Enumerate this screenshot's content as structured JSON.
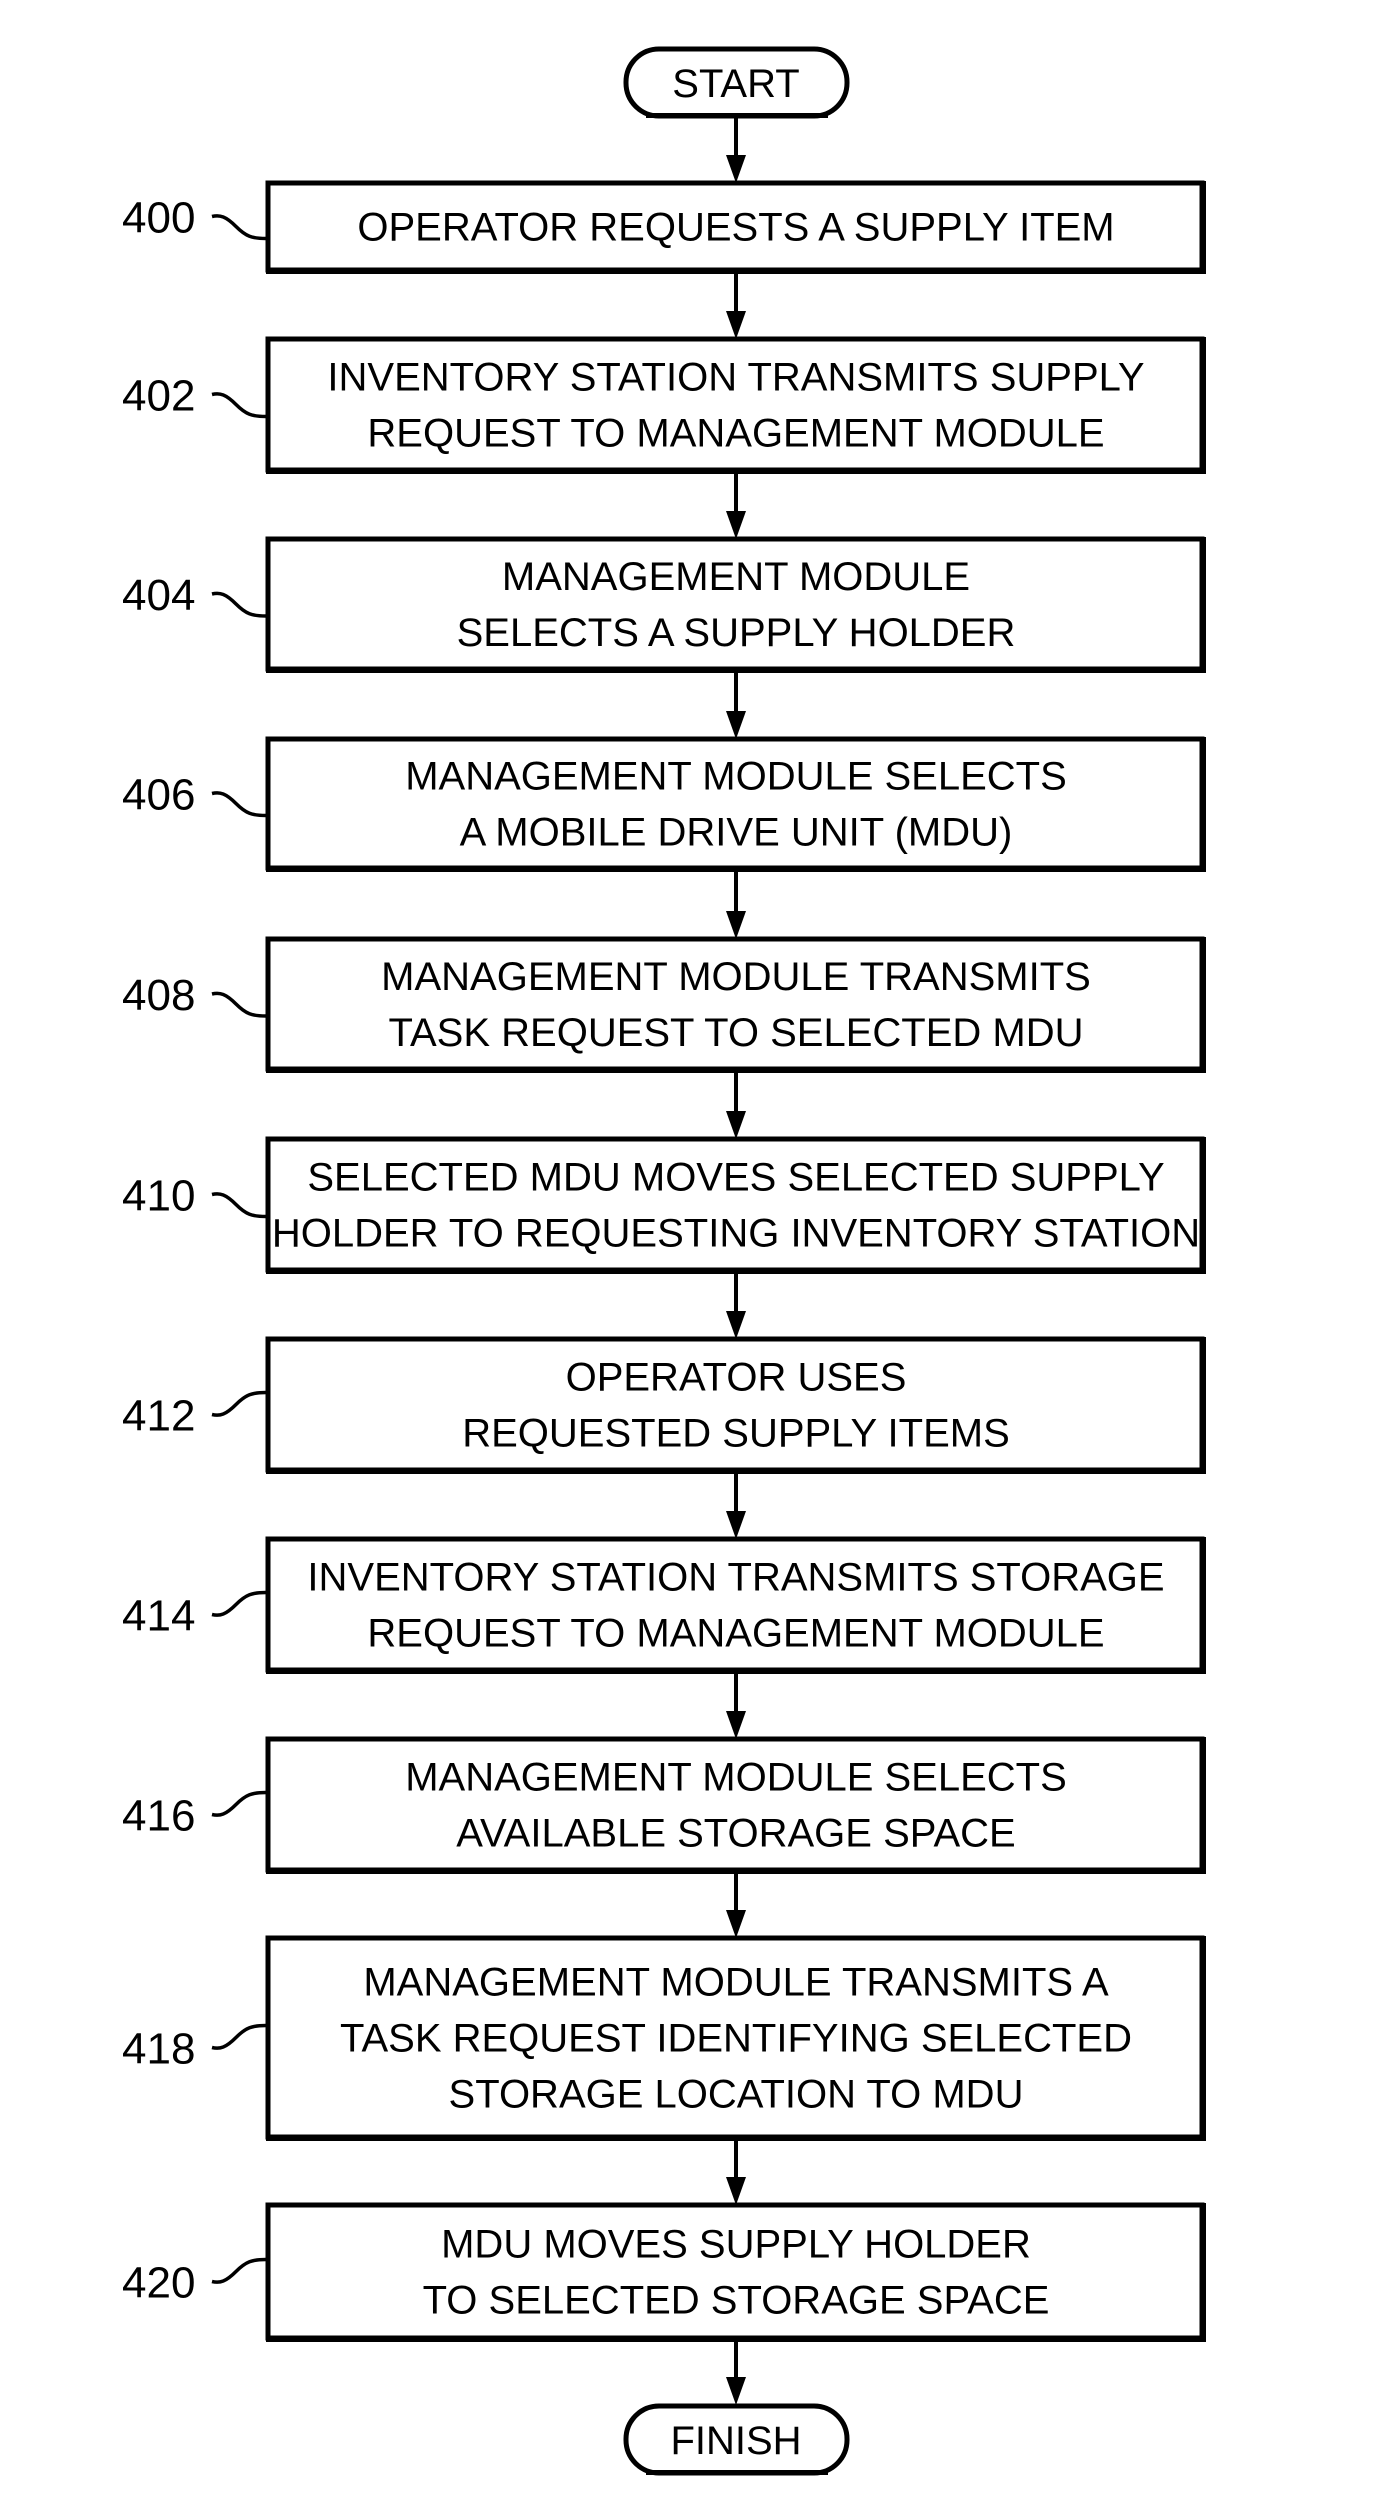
{
  "figure": {
    "type": "flowchart",
    "colors": {
      "stroke": "#000000",
      "background": "#ffffff",
      "text": "#000000"
    }
  },
  "start": {
    "label": "START"
  },
  "finish": {
    "label": "FINISH"
  },
  "steps": [
    {
      "ref": "400",
      "lines": [
        "OPERATOR REQUESTS A SUPPLY ITEM"
      ]
    },
    {
      "ref": "402",
      "lines": [
        "INVENTORY STATION TRANSMITS SUPPLY",
        "REQUEST TO MANAGEMENT MODULE"
      ]
    },
    {
      "ref": "404",
      "lines": [
        "MANAGEMENT MODULE",
        "SELECTS A SUPPLY HOLDER"
      ]
    },
    {
      "ref": "406",
      "lines": [
        "MANAGEMENT MODULE SELECTS",
        "A MOBILE DRIVE UNIT (MDU)"
      ]
    },
    {
      "ref": "408",
      "lines": [
        "MANAGEMENT MODULE TRANSMITS",
        "TASK REQUEST TO SELECTED MDU"
      ]
    },
    {
      "ref": "410",
      "lines": [
        "SELECTED MDU MOVES SELECTED SUPPLY",
        "HOLDER TO REQUESTING INVENTORY STATION"
      ]
    },
    {
      "ref": "412",
      "lines": [
        "OPERATOR USES",
        "REQUESTED SUPPLY ITEMS"
      ]
    },
    {
      "ref": "414",
      "lines": [
        "INVENTORY STATION TRANSMITS STORAGE",
        "REQUEST TO MANAGEMENT MODULE"
      ]
    },
    {
      "ref": "416",
      "lines": [
        "MANAGEMENT MODULE SELECTS",
        "AVAILABLE STORAGE SPACE"
      ]
    },
    {
      "ref": "418",
      "lines": [
        "MANAGEMENT MODULE TRANSMITS A",
        "TASK REQUEST IDENTIFYING SELECTED",
        "STORAGE LOCATION TO MDU"
      ]
    },
    {
      "ref": "420",
      "lines": [
        "MDU MOVES SUPPLY HOLDER",
        "TO SELECTED STORAGE SPACE"
      ]
    }
  ]
}
